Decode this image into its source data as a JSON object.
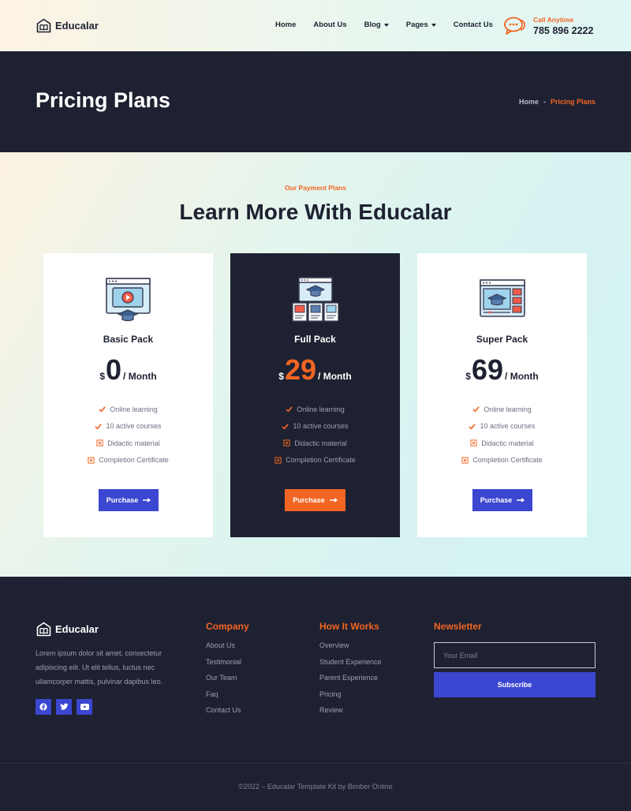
{
  "header": {
    "brand": "Educalar",
    "nav": [
      {
        "label": "Home",
        "dropdown": false
      },
      {
        "label": "About Us",
        "dropdown": false
      },
      {
        "label": "Blog",
        "dropdown": true
      },
      {
        "label": "Pages",
        "dropdown": true
      },
      {
        "label": "Contact Us",
        "dropdown": false
      }
    ],
    "call_label": "Call Anytime",
    "call_number": "785 896 2222"
  },
  "banner": {
    "title": "Pricing Plans",
    "breadcrumb": {
      "home": "Home",
      "separator": "-",
      "current": "Pricing Plans"
    }
  },
  "pricing": {
    "eyebrow": "Our Payment Plans",
    "title": "Learn More With Educalar",
    "plans": [
      {
        "name": "Basic Pack",
        "currency": "$",
        "amount": "0",
        "period": "/ Month",
        "icon": "video-lesson-icon",
        "features": [
          {
            "text": "Online learning",
            "included": true
          },
          {
            "text": "10 active courses",
            "included": true
          },
          {
            "text": "Didactic material",
            "included": false
          },
          {
            "text": "Completion Certificate",
            "included": false
          }
        ],
        "button": "Purchase"
      },
      {
        "name": "Full Pack",
        "currency": "$",
        "amount": "29",
        "period": "/ Month",
        "icon": "course-library-icon",
        "features": [
          {
            "text": "Online learning",
            "included": true
          },
          {
            "text": "10 active courses",
            "included": true
          },
          {
            "text": "Didactic material",
            "included": false
          },
          {
            "text": "Completion Certificate",
            "included": false
          }
        ],
        "button": "Purchase"
      },
      {
        "name": "Super Pack",
        "currency": "$",
        "amount": "69",
        "period": "/ Month",
        "icon": "course-dashboard-icon",
        "features": [
          {
            "text": "Online learning",
            "included": true
          },
          {
            "text": "10 active courses",
            "included": true
          },
          {
            "text": "Didactic material",
            "included": false
          },
          {
            "text": "Completion Certificate",
            "included": false
          }
        ],
        "button": "Purchase"
      }
    ]
  },
  "footer": {
    "brand": "Educalar",
    "about": "Lorem ipsum dolor sit amet, consectetur adipiscing elit. Ut elit tellus, luctus nec ullamcorper mattis, pulvinar dapibus leo.",
    "socials": [
      "facebook-icon",
      "twitter-icon",
      "youtube-icon"
    ],
    "company": {
      "heading": "Company",
      "links": [
        "About Us",
        "Testimonial",
        "Our Team",
        "Faq",
        "Contact Us"
      ]
    },
    "how": {
      "heading": "How It Works",
      "links": [
        "Overview",
        "Student Experience",
        "Parent Experience",
        "Pricing",
        "Review"
      ]
    },
    "newsletter": {
      "heading": "Newsletter",
      "placeholder": "Your Email",
      "button": "Subscribe"
    },
    "copyright": "©2022 – Educalar Template Kit by Bimber Online"
  },
  "colors": {
    "accent": "#f26522",
    "primary": "#3b46d1",
    "dark": "#1e2131"
  }
}
